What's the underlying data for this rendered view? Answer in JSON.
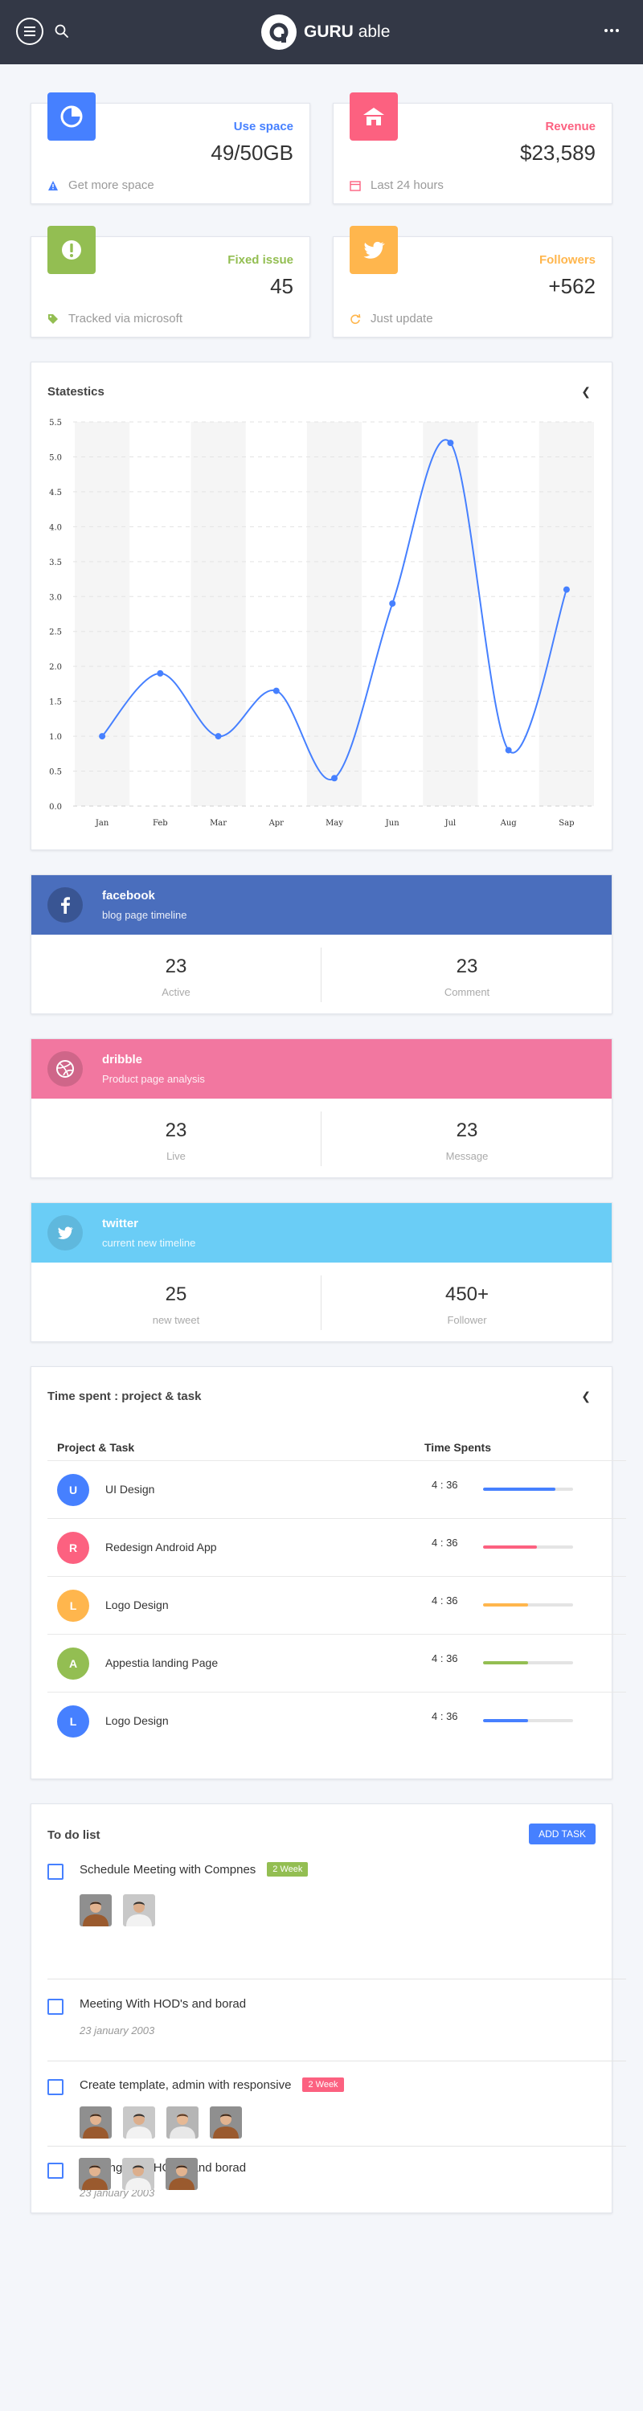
{
  "header": {
    "brand_bold": "GURU",
    "brand_light": "able"
  },
  "widgets": [
    {
      "label": "Use space",
      "value": "49/50GB",
      "footer": "Get more space",
      "color": "#4680ff",
      "icon": "pie-chart-icon",
      "footer_icon": "warning-icon"
    },
    {
      "label": "Revenue",
      "value": "$23,589",
      "footer": "Last 24 hours",
      "color": "#fc6180",
      "icon": "home-icon",
      "footer_icon": "calendar-icon"
    },
    {
      "label": "Fixed issue",
      "value": "45",
      "footer": "Tracked via microsoft",
      "color": "#93be52",
      "icon": "alert-icon",
      "footer_icon": "tag-icon"
    },
    {
      "label": "Followers",
      "value": "+562",
      "footer": "Just update",
      "color": "#ffb64d",
      "icon": "twitter-icon",
      "footer_icon": "refresh-icon"
    }
  ],
  "statistics": {
    "title": "Statestics",
    "chart_data": {
      "type": "line",
      "categories": [
        "Jan",
        "Feb",
        "Mar",
        "Apr",
        "May",
        "Jun",
        "Jul",
        "Aug",
        "Sap"
      ],
      "series": [
        {
          "values": [
            1.0,
            1.9,
            1.0,
            1.65,
            0.4,
            2.9,
            5.2,
            0.8,
            3.1
          ]
        }
      ],
      "ylim": [
        0,
        5.5
      ],
      "yticks": [
        "0.0",
        "0.5",
        "1.0",
        "1.5",
        "2.0",
        "2.5",
        "3.0",
        "3.5",
        "4.0",
        "4.5",
        "5.0",
        "5.5"
      ],
      "grid": true,
      "line_color": "#4680ff"
    }
  },
  "social": [
    {
      "name": "facebook",
      "sub": "blog page timeline",
      "color": "#4a6ebd",
      "icon": "facebook-icon",
      "stats": [
        {
          "value": "23",
          "label": "Active"
        },
        {
          "value": "23",
          "label": "Comment"
        }
      ]
    },
    {
      "name": "dribble",
      "sub": "Product page analysis",
      "color": "#f277a0",
      "icon": "dribbble-icon",
      "stats": [
        {
          "value": "23",
          "label": "Live"
        },
        {
          "value": "23",
          "label": "Message"
        }
      ]
    },
    {
      "name": "twitter",
      "sub": "current new timeline",
      "color": "#6acdf6",
      "icon": "twitter-icon",
      "stats": [
        {
          "value": "25",
          "label": "new tweet"
        },
        {
          "value": "450+",
          "label": "Follower"
        }
      ]
    }
  ],
  "time_spent": {
    "title": "Time spent : project & task",
    "col_project": "Project & Task",
    "col_time": "Time Spents",
    "rows": [
      {
        "initial": "U",
        "task": "UI Design",
        "time": "4 : 36",
        "progress": 0.8,
        "color": "#4680ff"
      },
      {
        "initial": "R",
        "task": "Redesign Android App",
        "time": "4 : 36",
        "progress": 0.6,
        "color": "#fc6180"
      },
      {
        "initial": "L",
        "task": "Logo Design",
        "time": "4 : 36",
        "progress": 0.5,
        "color": "#ffb64d"
      },
      {
        "initial": "A",
        "task": "Appestia landing Page",
        "time": "4 : 36",
        "progress": 0.5,
        "color": "#93be52"
      },
      {
        "initial": "L",
        "task": "Logo Design",
        "time": "4 : 36",
        "progress": 0.5,
        "color": "#4680ff"
      }
    ]
  },
  "todo": {
    "title": "To do list",
    "add_label": "ADD TASK",
    "items": [
      {
        "title": "Schedule Meeting with Compnes",
        "badge": "2 Week",
        "badge_color": "#93be52",
        "photos": 2
      },
      {
        "title": "Meeting With HOD's and borad",
        "date": "23 january 2003",
        "photos": 0
      },
      {
        "title": "Create template, admin with responsive",
        "badge": "2 Week",
        "badge_color": "#fc6180",
        "photos": 4
      },
      {
        "title": "Meeting With HOD's and borad",
        "date": "23 january 2003",
        "photos": 3
      }
    ]
  }
}
